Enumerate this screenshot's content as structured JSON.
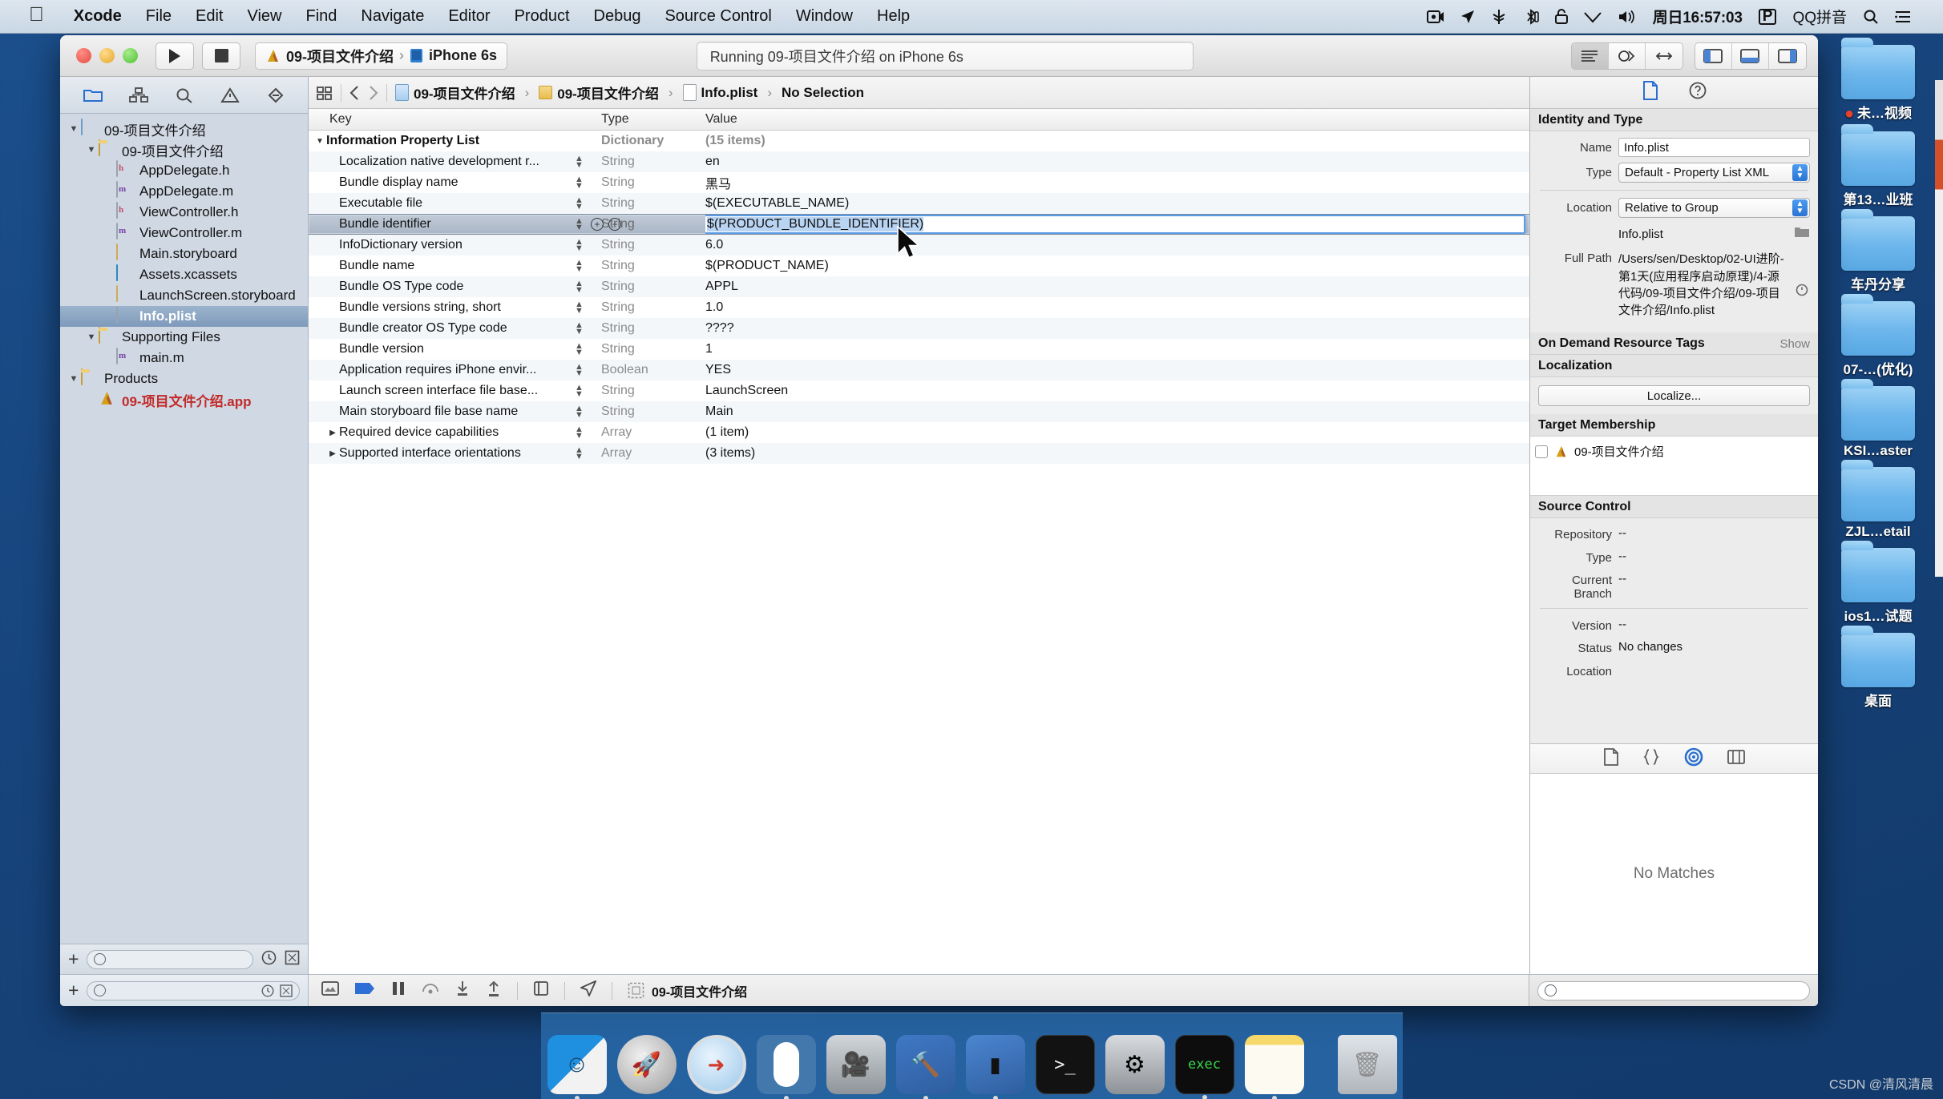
{
  "menubar": {
    "apple_icon": "apple-logo",
    "items": [
      {
        "label": "Xcode",
        "bold": true
      },
      {
        "label": "File",
        "bold": false
      },
      {
        "label": "Edit",
        "bold": false
      },
      {
        "label": "View",
        "bold": false
      },
      {
        "label": "Find",
        "bold": false
      },
      {
        "label": "Navigate",
        "bold": false
      },
      {
        "label": "Editor",
        "bold": false
      },
      {
        "label": "Product",
        "bold": false
      },
      {
        "label": "Debug",
        "bold": false
      },
      {
        "label": "Source Control",
        "bold": false
      },
      {
        "label": "Window",
        "bold": false
      },
      {
        "label": "Help",
        "bold": false
      }
    ],
    "status": {
      "screen_record_icon": "screen-record-icon",
      "location_icon": "location-arrow-icon",
      "dropbox_icon": "dropbox-icon",
      "bluetooth_icon": "bluetooth-icon",
      "lock_icon": "lock-icon",
      "wifi_icon": "wifi-icon",
      "volume_icon": "volume-icon",
      "clock": "周日16:57:03",
      "parallels_badge": "P",
      "input_method": "QQ拼音",
      "spotlight_icon": "search-icon",
      "notification_icon": "notification-center-icon"
    }
  },
  "xcode": {
    "toolbar": {
      "run_icon": "play-icon",
      "stop_icon": "stop-icon",
      "scheme_project": "09-项目文件介绍",
      "scheme_sep": "›",
      "scheme_device": "iPhone 6s",
      "status_text": "Running 09-项目文件介绍 on iPhone 6s",
      "editor_segments": [
        "standard-editor-icon",
        "assistant-editor-icon",
        "version-editor-icon"
      ],
      "view_segments": [
        "hide-navigator-icon",
        "hide-debug-area-icon",
        "hide-utilities-icon"
      ]
    },
    "navigator": {
      "tabs": [
        "project-navigator-icon",
        "symbol-navigator-icon",
        "find-navigator-icon",
        "issue-navigator-icon",
        "test-navigator-icon",
        "debug-navigator-icon",
        "breakpoint-navigator-icon",
        "report-navigator-icon"
      ],
      "tree": [
        {
          "label": "09-项目文件介绍",
          "indent": 0,
          "tri": "down",
          "icon": "project-icon",
          "selected": false,
          "style": "normal"
        },
        {
          "label": "09-项目文件介绍",
          "indent": 1,
          "tri": "down",
          "icon": "folder-icon",
          "selected": false,
          "style": "normal"
        },
        {
          "label": "AppDelegate.h",
          "indent": 2,
          "tri": "",
          "icon": "header-file-icon",
          "badge": "h",
          "selected": false,
          "style": "normal"
        },
        {
          "label": "AppDelegate.m",
          "indent": 2,
          "tri": "",
          "icon": "source-file-icon",
          "badge": "m",
          "selected": false,
          "style": "normal"
        },
        {
          "label": "ViewController.h",
          "indent": 2,
          "tri": "",
          "icon": "header-file-icon",
          "badge": "h",
          "selected": false,
          "style": "normal"
        },
        {
          "label": "ViewController.m",
          "indent": 2,
          "tri": "",
          "icon": "source-file-icon",
          "badge": "m",
          "selected": false,
          "style": "normal"
        },
        {
          "label": "Main.storyboard",
          "indent": 2,
          "tri": "",
          "icon": "storyboard-icon",
          "badge": "",
          "selected": false,
          "style": "normal"
        },
        {
          "label": "Assets.xcassets",
          "indent": 2,
          "tri": "",
          "icon": "assets-icon",
          "badge": "",
          "selected": false,
          "style": "normal"
        },
        {
          "label": "LaunchScreen.storyboard",
          "indent": 2,
          "tri": "",
          "icon": "storyboard-icon",
          "badge": "",
          "selected": false,
          "style": "normal"
        },
        {
          "label": "Info.plist",
          "indent": 2,
          "tri": "",
          "icon": "plist-icon",
          "badge": "",
          "selected": true,
          "style": "normal"
        },
        {
          "label": "Supporting Files",
          "indent": 1,
          "tri": "down",
          "icon": "folder-icon",
          "selected": false,
          "style": "normal"
        },
        {
          "label": "main.m",
          "indent": 2,
          "tri": "",
          "icon": "source-file-icon",
          "badge": "m",
          "selected": false,
          "style": "normal"
        },
        {
          "label": "Products",
          "indent": 0,
          "tri": "down",
          "icon": "folder-icon",
          "selected": false,
          "style": "normal"
        },
        {
          "label": "09-项目文件介绍.app",
          "indent": 1,
          "tri": "",
          "icon": "app-product-icon",
          "badge": "",
          "selected": false,
          "style": "product"
        }
      ],
      "filter": {
        "add_icon": "add-icon",
        "filter_icon": "filter-icon",
        "placeholder": ""
      }
    },
    "jump_bar": {
      "related_icon": "related-items-icon",
      "back_icon": "chevron-left-icon",
      "forward_icon": "chevron-right-icon",
      "crumbs": [
        {
          "label": "09-项目文件介绍",
          "icon": "project-icon"
        },
        {
          "label": "09-项目文件介绍",
          "icon": "folder-icon"
        },
        {
          "label": "Info.plist",
          "icon": "plist-icon"
        },
        {
          "label": "No Selection",
          "icon": ""
        }
      ],
      "sep": "›"
    },
    "plist": {
      "columns": [
        "Key",
        "Type",
        "Value"
      ],
      "rows": [
        {
          "key": "Information Property List",
          "type": "Dictionary",
          "value": "(15 items)",
          "indent": 0,
          "tri": "down",
          "selected": false,
          "editing": false
        },
        {
          "key": "Localization native development r...",
          "type": "String",
          "value": "en",
          "indent": 1,
          "tri": "",
          "selected": false,
          "editing": false
        },
        {
          "key": "Bundle display name",
          "type": "String",
          "value": "黑马",
          "indent": 1,
          "tri": "",
          "selected": false,
          "editing": false
        },
        {
          "key": "Executable file",
          "type": "String",
          "value": "$(EXECUTABLE_NAME)",
          "indent": 1,
          "tri": "",
          "selected": false,
          "editing": false
        },
        {
          "key": "Bundle identifier",
          "type": "String",
          "value": "$(PRODUCT_BUNDLE_IDENTIFIER)",
          "indent": 1,
          "tri": "",
          "selected": true,
          "editing": true
        },
        {
          "key": "InfoDictionary version",
          "type": "String",
          "value": "6.0",
          "indent": 1,
          "tri": "",
          "selected": false,
          "editing": false
        },
        {
          "key": "Bundle name",
          "type": "String",
          "value": "$(PRODUCT_NAME)",
          "indent": 1,
          "tri": "",
          "selected": false,
          "editing": false
        },
        {
          "key": "Bundle OS Type code",
          "type": "String",
          "value": "APPL",
          "indent": 1,
          "tri": "",
          "selected": false,
          "editing": false
        },
        {
          "key": "Bundle versions string, short",
          "type": "String",
          "value": "1.0",
          "indent": 1,
          "tri": "",
          "selected": false,
          "editing": false
        },
        {
          "key": "Bundle creator OS Type code",
          "type": "String",
          "value": "????",
          "indent": 1,
          "tri": "",
          "selected": false,
          "editing": false
        },
        {
          "key": "Bundle version",
          "type": "String",
          "value": "1",
          "indent": 1,
          "tri": "",
          "selected": false,
          "editing": false
        },
        {
          "key": "Application requires iPhone envir...",
          "type": "Boolean",
          "value": "YES",
          "indent": 1,
          "tri": "",
          "selected": false,
          "editing": false
        },
        {
          "key": "Launch screen interface file base...",
          "type": "String",
          "value": "LaunchScreen",
          "indent": 1,
          "tri": "",
          "selected": false,
          "editing": false
        },
        {
          "key": "Main storyboard file base name",
          "type": "String",
          "value": "Main",
          "indent": 1,
          "tri": "",
          "selected": false,
          "editing": false
        },
        {
          "key": "Required device capabilities",
          "type": "Array",
          "value": "(1 item)",
          "indent": 1,
          "tri": "right",
          "selected": false,
          "editing": false
        },
        {
          "key": "Supported interface orientations",
          "type": "Array",
          "value": "(3 items)",
          "indent": 1,
          "tri": "right",
          "selected": false,
          "editing": false
        }
      ]
    },
    "inspector": {
      "tabs": [
        "file-inspector-icon",
        "quick-help-icon"
      ],
      "identity": {
        "title": "Identity and Type",
        "name_label": "Name",
        "name_value": "Info.plist",
        "type_label": "Type",
        "type_value": "Default - Property List XML",
        "location_label": "Location",
        "location_value": "Relative to Group",
        "relative_path": "Info.plist",
        "folder_icon": "folder-icon",
        "full_path_label": "Full Path",
        "full_path_value": "/Users/sen/Desktop/02-UI进阶-第1天(应用程序启动原理)/4-源代码/09-项目文件介绍/09-项目文件介绍/Info.plist",
        "reveal_icon": "reveal-in-finder-icon"
      },
      "on_demand": {
        "title": "On Demand Resource Tags",
        "show_label": "Show"
      },
      "localization": {
        "title": "Localization",
        "button_label": "Localize..."
      },
      "target_membership": {
        "title": "Target Membership",
        "checked": false,
        "target_name": "09-项目文件介绍",
        "target_icon": "app-product-icon"
      },
      "source_control": {
        "title": "Source Control",
        "fields": [
          {
            "label": "Repository",
            "value": "--"
          },
          {
            "label": "Type",
            "value": "--"
          },
          {
            "label": "Current Branch",
            "value": "--"
          }
        ],
        "fields2": [
          {
            "label": "Version",
            "value": "--"
          },
          {
            "label": "Status",
            "value": "No changes"
          },
          {
            "label": "Location",
            "value": ""
          }
        ]
      },
      "library": {
        "tabs": [
          "file-template-library-icon",
          "code-snippet-library-icon",
          "object-library-icon",
          "media-library-icon"
        ],
        "empty_text": "No Matches",
        "filter_icon": "filter-icon"
      }
    },
    "bottom_bar": {
      "add_icon": "add-icon",
      "filter_icon": "filter-icon",
      "filter_placeholder": "",
      "recent_icon": "recent-icon",
      "scope_icon": "scope-icon",
      "debug_icons": [
        "show-debug-area-icon",
        "breakpoints-icon",
        "pause-icon",
        "step-over-icon",
        "step-into-icon",
        "step-out-icon",
        "simulate-location-icon",
        "debug-view-hierarchy-icon"
      ],
      "scope_label": "09-项目文件介绍",
      "scope_thumb_icon": "stack-frame-icon",
      "right_filter_icon": "filter-icon"
    }
  },
  "desktop": {
    "folders": [
      {
        "label": "未…视频",
        "has_dot": true
      },
      {
        "label": "第13…业班",
        "has_dot": false
      },
      {
        "label": "车丹分享",
        "has_dot": false
      },
      {
        "label": "07-…(优化)",
        "has_dot": false
      },
      {
        "label": "KSI…aster",
        "has_dot": false
      },
      {
        "label": "ZJL…etail",
        "has_dot": false
      },
      {
        "label": "ios1…试题",
        "has_dot": false
      },
      {
        "label": "桌面",
        "has_dot": false
      }
    ]
  },
  "dock": {
    "apps": [
      {
        "name": "Finder",
        "cls": "d-finder",
        "glyph": "",
        "running": true
      },
      {
        "name": "Launchpad",
        "cls": "d-launch",
        "glyph": "🚀",
        "running": false
      },
      {
        "name": "Safari",
        "cls": "d-safari",
        "glyph": "",
        "running": false
      },
      {
        "name": "Mouse",
        "cls": "d-mouse",
        "glyph": "",
        "running": true
      },
      {
        "name": "iMovie",
        "cls": "d-imovie",
        "glyph": "🎬",
        "running": false
      },
      {
        "name": "Xcode",
        "cls": "d-xcode",
        "glyph": "🔨",
        "running": true
      },
      {
        "name": "Xcode Beta",
        "cls": "d-xcode2",
        "glyph": "",
        "running": true
      },
      {
        "name": "Terminal",
        "cls": "d-term",
        "glyph": "",
        "running": false
      },
      {
        "name": "System Preferences",
        "cls": "d-sysp",
        "glyph": "⚙",
        "running": false
      },
      {
        "name": "Executable",
        "cls": "d-exec",
        "glyph": "",
        "running": true
      },
      {
        "name": "Notes",
        "cls": "d-notes",
        "glyph": "",
        "running": true
      },
      {
        "name": "Trash",
        "cls": "d-trash",
        "glyph": "",
        "running": false
      }
    ],
    "terminal_prompt": ">_"
  },
  "watermark": "CSDN @清风清晨"
}
